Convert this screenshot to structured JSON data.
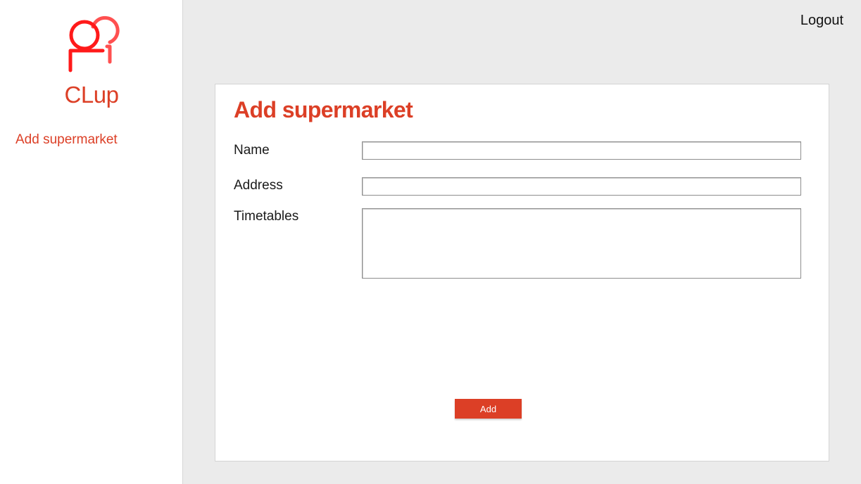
{
  "app": {
    "brand": "CLup",
    "logo_icon": "people-icon",
    "accent_color": "#dc3f26"
  },
  "sidebar": {
    "items": [
      {
        "label": "Add supermarket"
      }
    ]
  },
  "header": {
    "logout_label": "Logout"
  },
  "form": {
    "title": "Add supermarket",
    "fields": {
      "name": {
        "label": "Name",
        "value": ""
      },
      "address": {
        "label": "Address",
        "value": ""
      },
      "timetables": {
        "label": "Timetables",
        "value": ""
      }
    },
    "submit_label": "Add"
  }
}
